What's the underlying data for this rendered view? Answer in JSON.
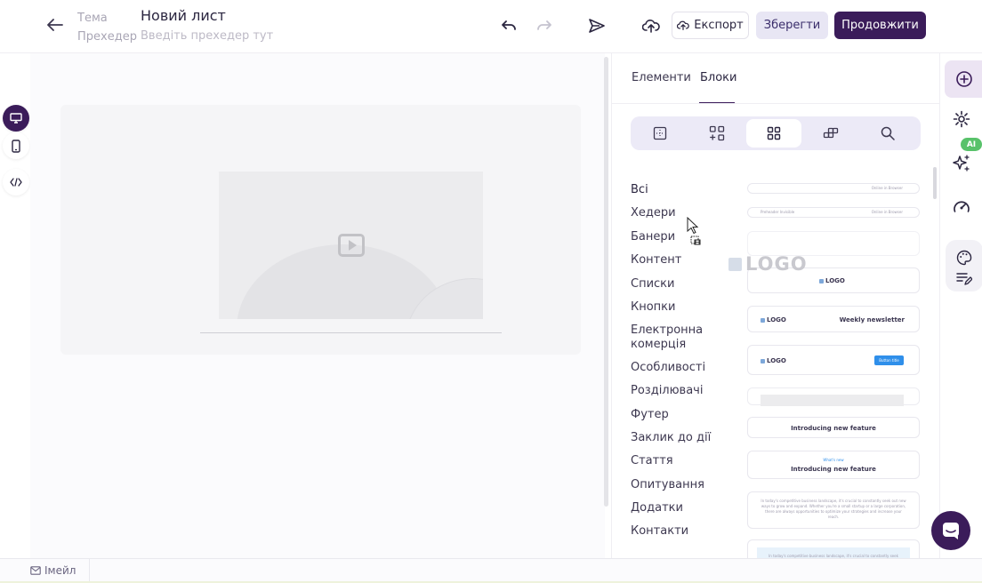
{
  "header": {
    "theme_label": "Тема",
    "preheader_label": "Прехедер",
    "doc_title": "Новий лист",
    "preheader_placeholder": "Введіть прехедер тут",
    "export_label": "Експорт",
    "save_label": "Зберегти",
    "continue_label": "Продовжити"
  },
  "panel": {
    "tabs": [
      {
        "label": "Елементи",
        "active": false
      },
      {
        "label": "Блоки",
        "active": true
      }
    ],
    "categories": [
      {
        "label": "Всі",
        "active": true
      },
      {
        "label": "Хедери"
      },
      {
        "label": "Банери"
      },
      {
        "label": "Контент"
      },
      {
        "label": "Списки"
      },
      {
        "label": "Кнопки"
      },
      {
        "label": "Електронна комерція"
      },
      {
        "label": "Особливості"
      },
      {
        "label": "Розділювачі"
      },
      {
        "label": "Футер"
      },
      {
        "label": "Заклик до дії"
      },
      {
        "label": "Стаття"
      },
      {
        "label": "Опитування"
      },
      {
        "label": "Додатки"
      },
      {
        "label": "Контакти"
      }
    ],
    "thumbs": {
      "t1_right": "Online in Browser",
      "t2_left": "Preheader Invisible",
      "t2_right": "Online in Browser",
      "logo": "LOGO",
      "weekly": "Weekly newsletter",
      "button_title": "Button title",
      "intro1": "Introducing new feature",
      "whats_new": "What's new",
      "intro2": "Introducing new feature",
      "para": "In today's competitive business landscape, it's crucial to constantly seek out new ways to grow and expand. Whether you're a small startup or a large corporation, there are always opportunities to optimize your strategies and increase your reach.",
      "para2": "In today's competitive business landscape, it's crucial to constantly seek"
    }
  },
  "drag_preview": {
    "logo": "LOGO"
  },
  "rail": {
    "ai_badge": "AI"
  },
  "footer": {
    "email_tab": "Імейл"
  },
  "colors": {
    "primary": "#3b1c5a",
    "accent_light": "#eceaf7",
    "ai_green": "#58c26a",
    "button_blue": "#2f8fea"
  }
}
